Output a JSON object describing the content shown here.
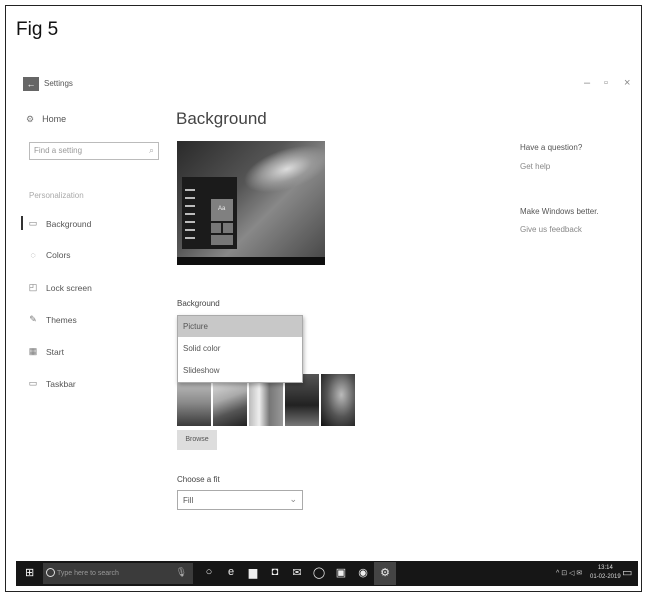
{
  "figure_label": "Fig 5",
  "window": {
    "back_label": "←",
    "title": "Settings",
    "minimize": "–",
    "restore": "▫",
    "close": "×"
  },
  "sidebar": {
    "home": "Home",
    "search_placeholder": "Find a setting",
    "section": "Personalization",
    "items": [
      {
        "label": "Background",
        "icon": "picture-icon"
      },
      {
        "label": "Colors",
        "icon": "palette-icon"
      },
      {
        "label": "Lock screen",
        "icon": "lock-screen-icon"
      },
      {
        "label": "Themes",
        "icon": "brush-icon"
      },
      {
        "label": "Start",
        "icon": "start-icon"
      },
      {
        "label": "Taskbar",
        "icon": "taskbar-icon"
      }
    ]
  },
  "main": {
    "title": "Background",
    "preview_tile_text": "Aa",
    "background_label": "Background",
    "dropdown_options": [
      "Picture",
      "Solid color",
      "Slideshow"
    ],
    "dropdown_selected": "Picture",
    "browse": "Browse",
    "fit_label": "Choose a fit",
    "fit_value": "Fill"
  },
  "right": {
    "question": "Have a question?",
    "get_help": "Get help",
    "better": "Make Windows better.",
    "feedback": "Give us feedback"
  },
  "taskbar": {
    "search_placeholder": "Type here to search",
    "time": "13:14",
    "date": "01-02-2019"
  }
}
